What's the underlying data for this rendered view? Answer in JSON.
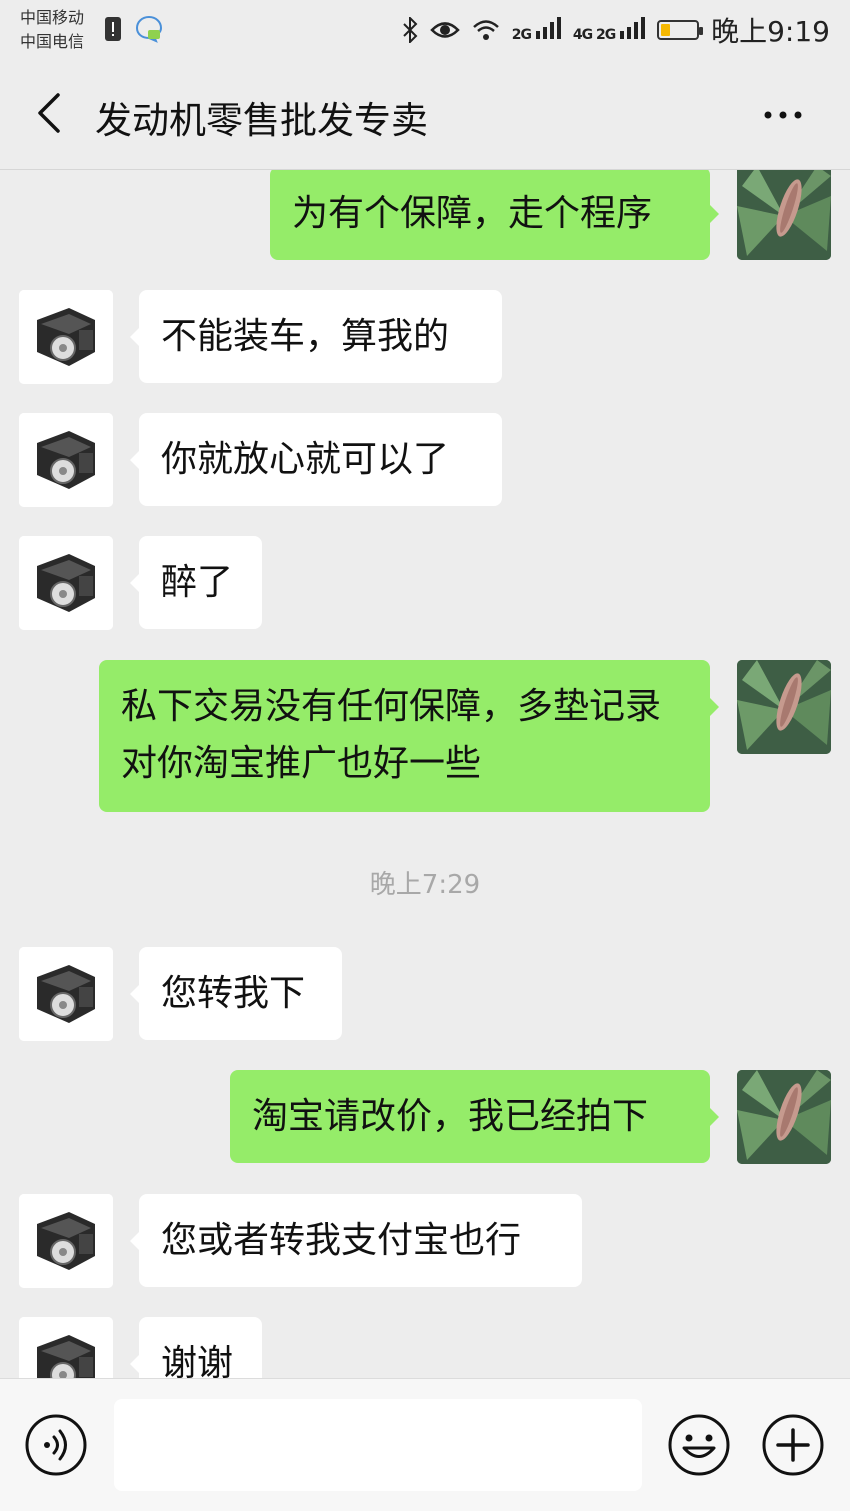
{
  "status_bar": {
    "carrier_1": "中国移动",
    "carrier_2": "中国电信",
    "signal_1": "2G",
    "signal_2": "4G 2G",
    "time": "晚上9:19"
  },
  "header": {
    "title": "发动机零售批发专卖"
  },
  "messages": [
    {
      "side": "out",
      "text": "为有个保障，走个程序"
    },
    {
      "side": "in",
      "text": "不能装车，算我的"
    },
    {
      "side": "in",
      "text": "你就放心就可以了"
    },
    {
      "side": "in",
      "text": "醉了"
    },
    {
      "side": "out",
      "text": "私下交易没有任何保障，多垫记录对你淘宝推广也好一些"
    },
    {
      "side": "in",
      "text": "您转我下"
    },
    {
      "side": "out",
      "text": "淘宝请改价，我已经拍下"
    },
    {
      "side": "in",
      "text": "您或者转我支付宝也行"
    },
    {
      "side": "in",
      "text": "谢谢"
    }
  ],
  "time_separator": "晚上7:29",
  "input": {
    "value": "",
    "placeholder": ""
  },
  "icons": {
    "back": "chevron-left-icon",
    "more": "more-dots-icon",
    "voice": "voice-icon",
    "emoji": "emoji-icon",
    "add": "plus-icon"
  },
  "colors": {
    "background": "#ededed",
    "outgoing_bubble": "#95ec69",
    "incoming_bubble": "#ffffff"
  }
}
